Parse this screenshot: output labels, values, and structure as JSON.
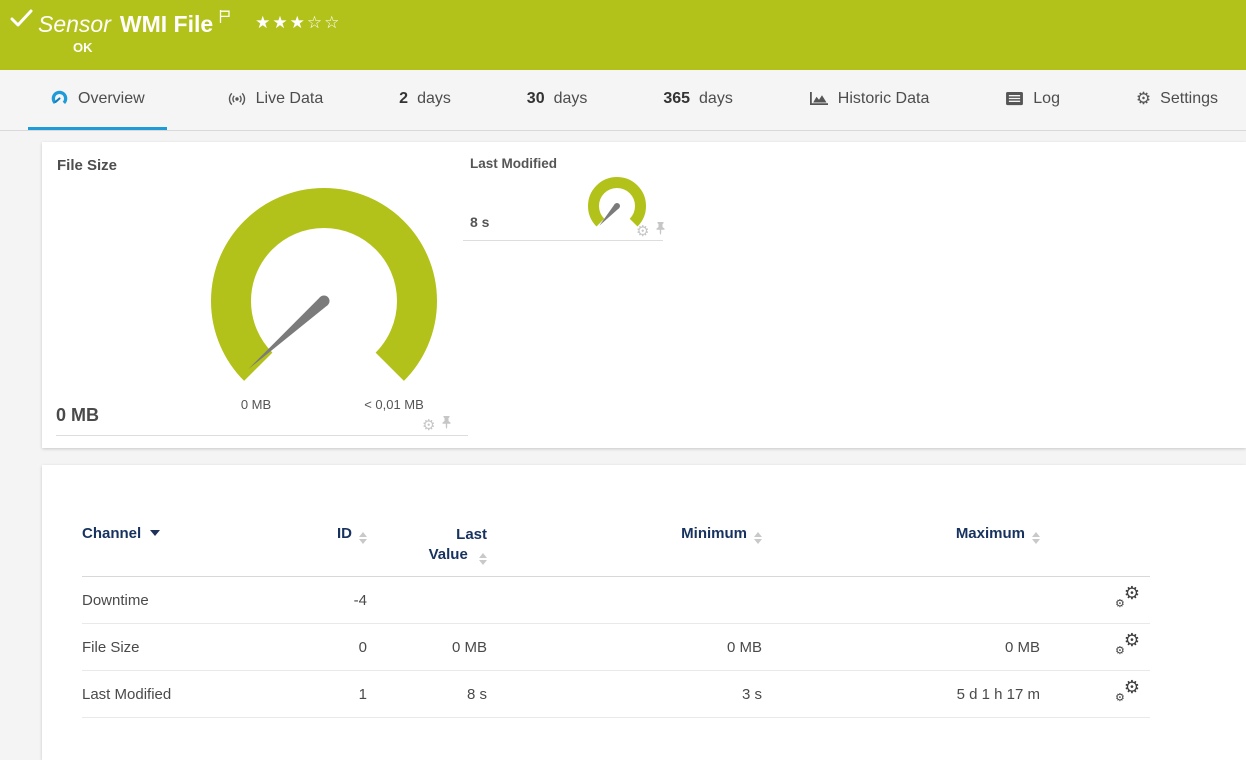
{
  "header": {
    "sensor_label": "Sensor",
    "sensor_name": "WMI File",
    "status": "OK",
    "rating_stars": "★★★☆☆"
  },
  "tabs": {
    "overview": "Overview",
    "live_data": "Live Data",
    "d2_num": "2",
    "d2_label": "days",
    "d30_num": "30",
    "d30_label": "days",
    "d365_num": "365",
    "d365_label": "days",
    "historic": "Historic Data",
    "log": "Log",
    "settings": "Settings"
  },
  "gauges": {
    "file_size": {
      "title": "File Size",
      "value": "0 MB",
      "min_label": "0 MB",
      "max_label": "< 0,01 MB"
    },
    "last_modified": {
      "title": "Last Modified",
      "value": "8 s"
    }
  },
  "channel_table": {
    "columns": {
      "channel": "Channel",
      "id": "ID",
      "last_value": "Last Value",
      "minimum": "Minimum",
      "maximum": "Maximum"
    },
    "rows": [
      {
        "channel": "Downtime",
        "id": "-4",
        "last_value": "",
        "minimum": "",
        "maximum": ""
      },
      {
        "channel": "File Size",
        "id": "0",
        "last_value": "0 MB",
        "minimum": "0 MB",
        "maximum": "0 MB"
      },
      {
        "channel": "Last Modified",
        "id": "1",
        "last_value": "8 s",
        "minimum": "3 s",
        "maximum": "5 d 1 h 17 m"
      }
    ]
  },
  "colors": {
    "brand_green": "#b2c21a",
    "accent_blue": "#1f9bd8",
    "header_navy": "#17325e",
    "needle_gray": "#7b7b7b"
  }
}
